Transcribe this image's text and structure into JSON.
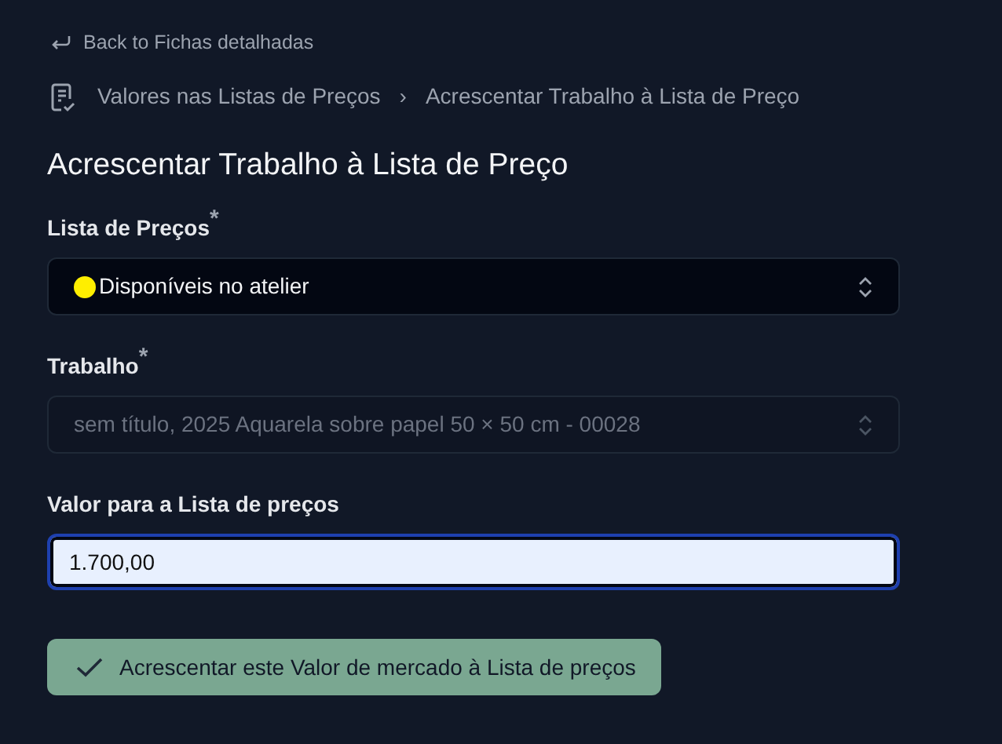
{
  "back_link": {
    "label": "Back to Fichas detalhadas"
  },
  "breadcrumb": [
    {
      "label": "Valores nas Listas de Preços"
    },
    {
      "label": "Acrescentar Trabalho à Lista de Preço"
    }
  ],
  "breadcrumb_separator": "›",
  "title": "Acrescentar Trabalho à Lista de Preço",
  "fields": [
    {
      "kind": "select",
      "label": "Lista de Preços$^{*}$",
      "value": "Disponíveis no atelier",
      "color": "#ffee00",
      "disabled": false
    },
    {
      "kind": "select",
      "label": "Trabalho$^{*}$",
      "value": "sem título, 2025 Aquarela sobre papel 50 × 50 cm - 00028",
      "disabled": true
    },
    {
      "kind": "input",
      "label": "Valor para a Lista de preços",
      "value": "1.700,00",
      "focused": true
    }
  ],
  "submit_button": {
    "label": "Acrescentar este Valor de mercado à Lista de preços"
  }
}
